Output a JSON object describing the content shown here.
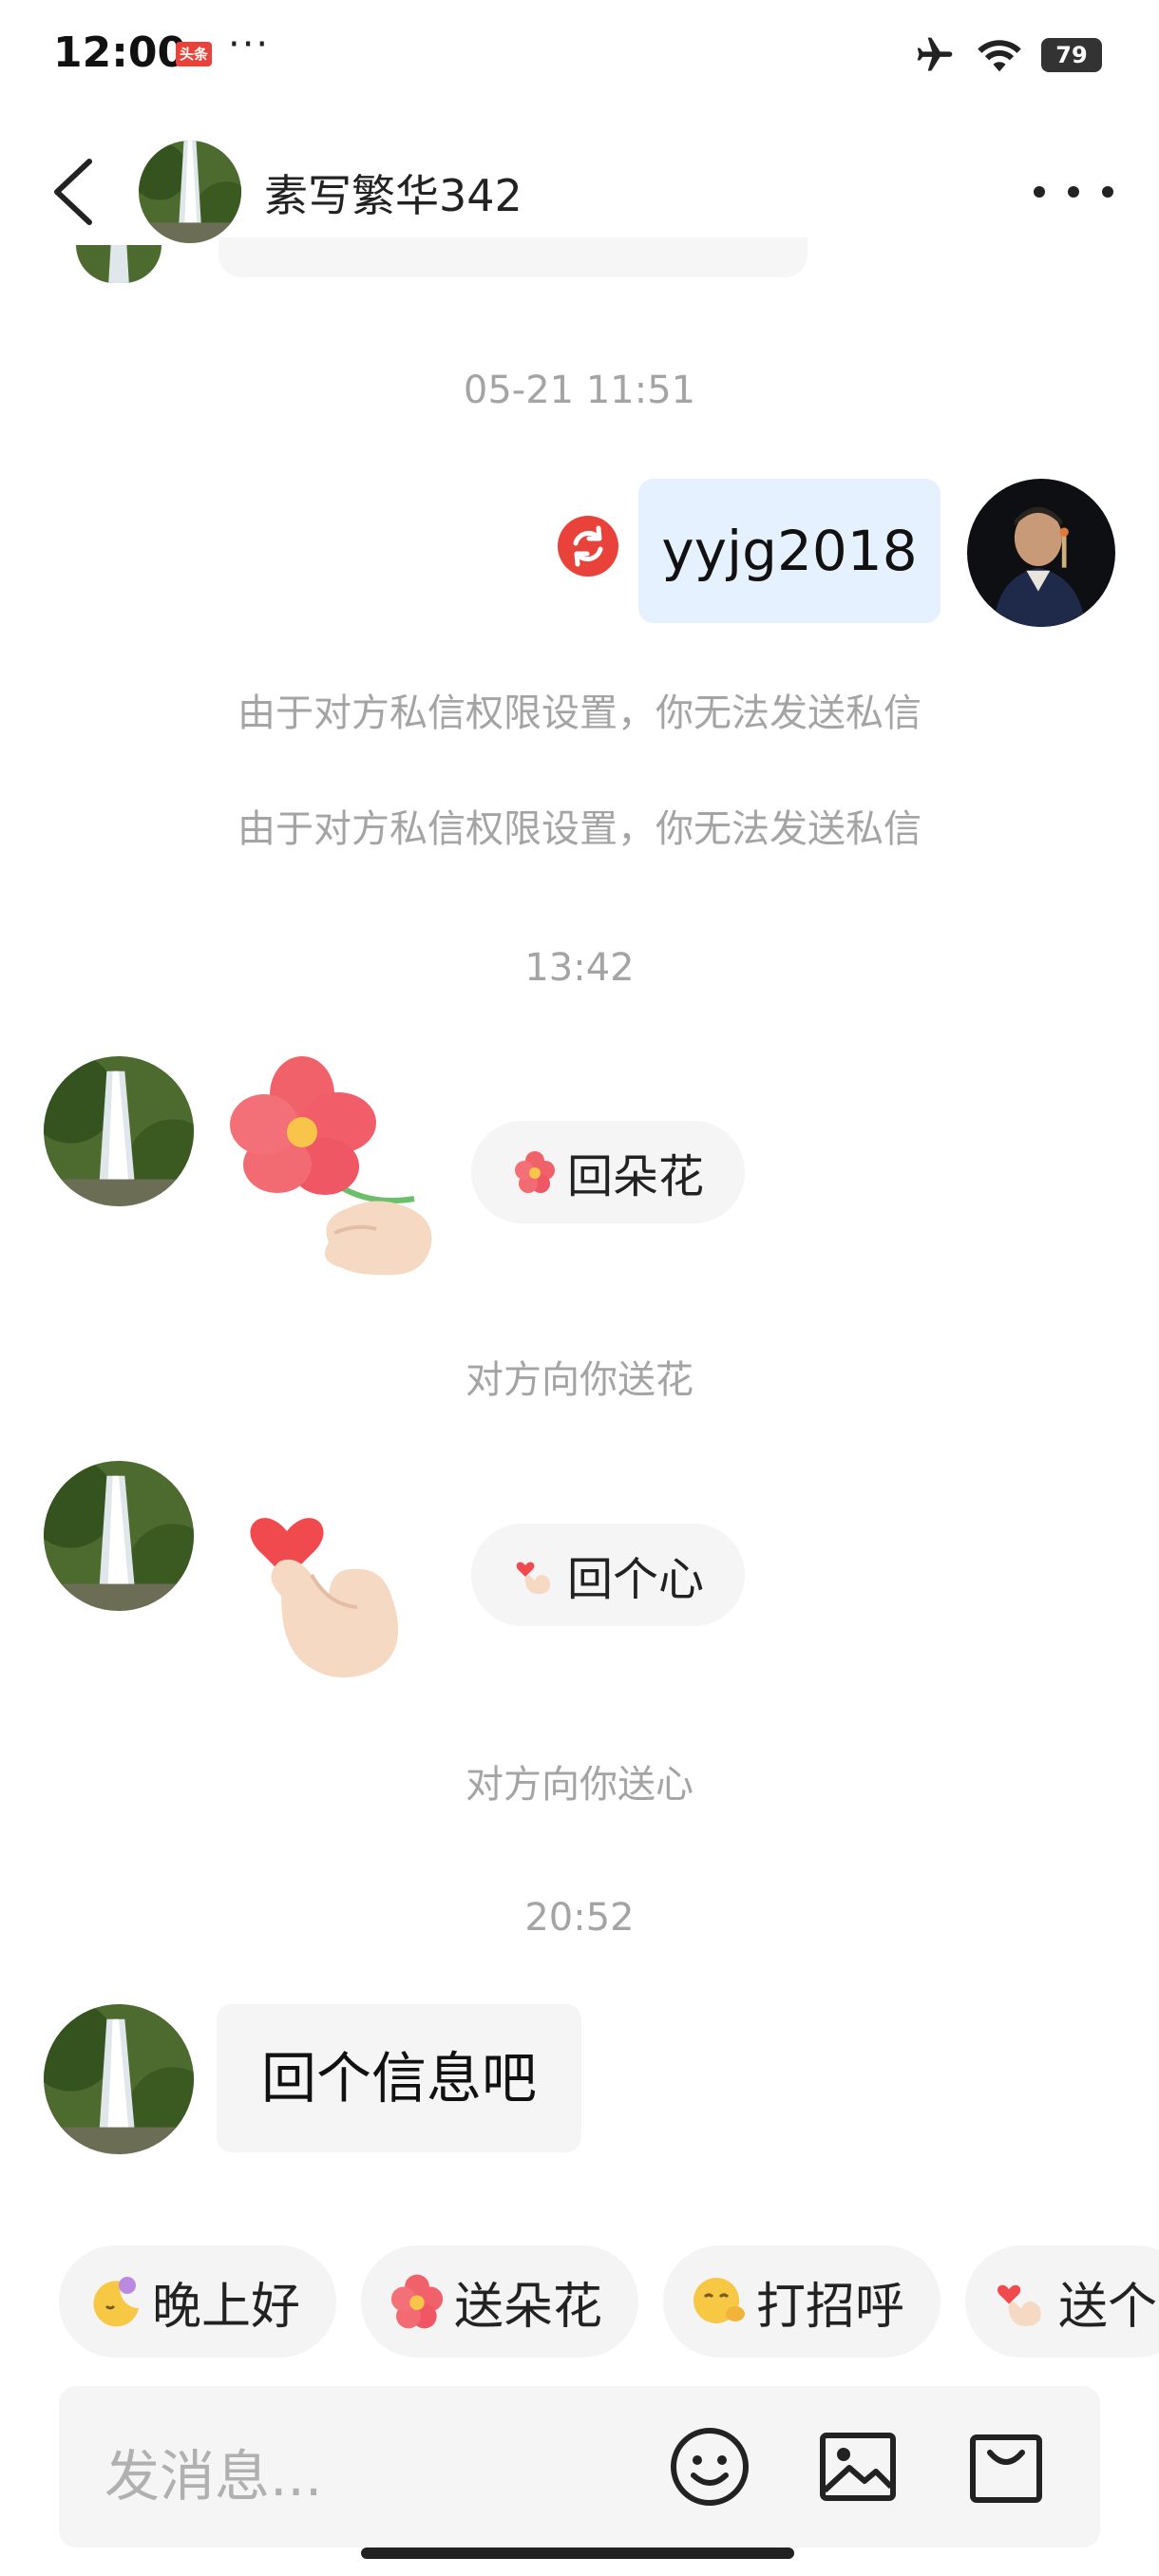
{
  "status_bar": {
    "time": "12:00",
    "app_badge": "头条",
    "dots": "···",
    "battery": "79"
  },
  "header": {
    "name": "素写繁华342"
  },
  "messages": {
    "ts1": "05-21 11:51",
    "my_message": "yyjg2018",
    "system1": "由于对方私信权限设置，你无法发送私信",
    "system2": "由于对方私信权限设置，你无法发送私信",
    "ts2": "13:42",
    "flower_reply": "回朵花",
    "flower_note": "对方向你送花",
    "heart_reply": "回个心",
    "heart_note": "对方向你送心",
    "ts3": "20:52",
    "text_message": "回个信息吧"
  },
  "quick_chips": [
    {
      "label": "晚上好",
      "icon": "moon-sleep-icon"
    },
    {
      "label": "送朵花",
      "icon": "flower-icon"
    },
    {
      "label": "打招呼",
      "icon": "wave-emoji-icon"
    },
    {
      "label": "送个",
      "icon": "finger-heart-icon"
    }
  ],
  "input": {
    "placeholder": "发消息..."
  },
  "colors": {
    "my_bubble": "#e5f1ff",
    "their_bubble": "#f5f5f5",
    "resend": "#e8423a",
    "muted_text": "#a4a4a4"
  }
}
